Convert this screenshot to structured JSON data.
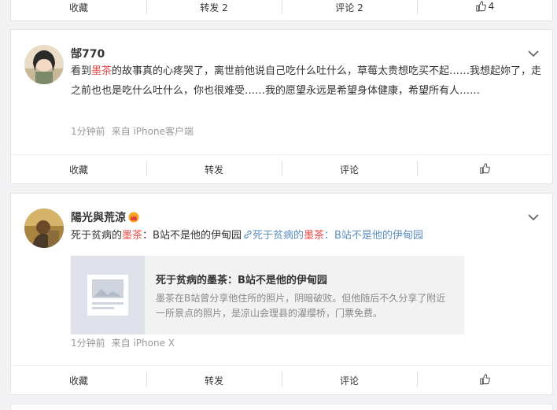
{
  "post0": {
    "actions": {
      "fav": "收藏",
      "repost": "转发 2",
      "comment": "评论 2",
      "like_count": "4"
    }
  },
  "post1": {
    "username": "郜770",
    "text": {
      "p1": "看到",
      "hl": "墨茶",
      "p2": "的故事真的心疼哭了，离世前他说自己吃什么吐什么，草莓太贵想吃买不起……我想起妳了，走之前也也是吃什么吐什么，你也很难受……我的愿望永远是希望身体健康，希望所有人……"
    },
    "time": "1分钟前",
    "source": "来自 iPhone客户端",
    "actions": {
      "fav": "收藏",
      "repost": "转发",
      "comment": "评论"
    }
  },
  "post2": {
    "username": "陽光與荒涼",
    "text": {
      "p1": "死于贫病的",
      "hl": "墨茶",
      "p2": "：B站不是他的伊甸园",
      "link1": "死于贫病的",
      "link_hl": "墨茶",
      "link2": "：B站不是他的伊甸园"
    },
    "card": {
      "title": "死于贫病的墨茶：B站不是他的伊甸园",
      "desc": "墨茶在B站曾分享他住所的照片，阴暗破败。但他随后不久分享了附近一所景点的照片，是凉山会理县的濯缨桥，门票免费。"
    },
    "time": "1分钟前",
    "source": "来自 iPhone X",
    "actions": {
      "fav": "收藏",
      "repost": "转发",
      "comment": "评论"
    }
  }
}
